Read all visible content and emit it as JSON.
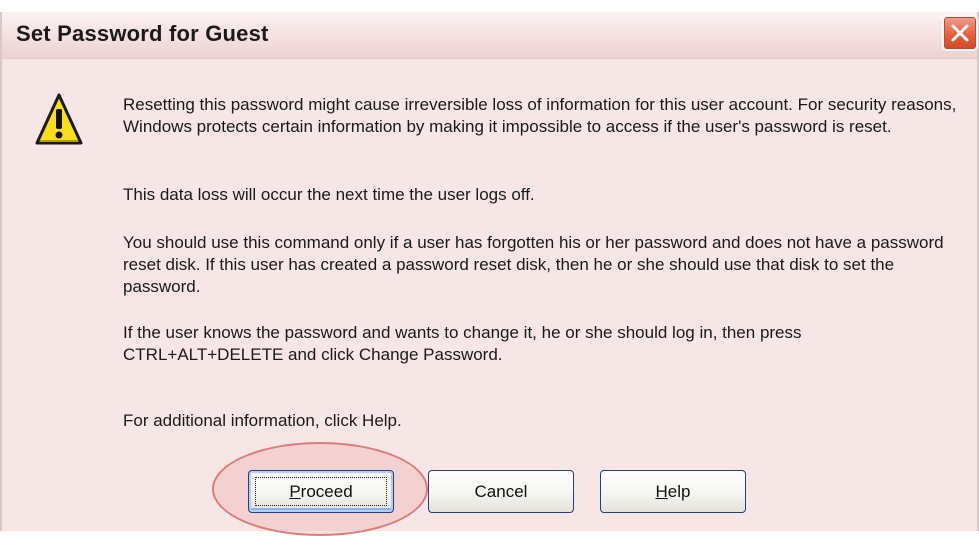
{
  "window": {
    "title": "Set Password for Guest"
  },
  "icons": {
    "close": "close-icon",
    "warning": "warning-icon"
  },
  "message": {
    "paragraphs": [
      "Resetting this password might cause irreversible loss of information for this user account. For security reasons, Windows protects certain information by making it impossible to access if the user's password is reset.",
      "This data loss will occur the next time the user logs off.",
      "You should use this command only if a user has forgotten his or her password and does not have a password reset disk. If this user has created a password reset disk, then he or she should use that disk to set the password.",
      "If the user knows the password and wants to change it, he or she should log in, then press CTRL+ALT+DELETE and click Change Password.",
      "For additional information, click Help."
    ]
  },
  "buttons": {
    "proceed": {
      "accel": "P",
      "rest": "roceed"
    },
    "cancel": {
      "label": "Cancel"
    },
    "help": {
      "accel": "H",
      "rest": "elp"
    }
  },
  "colors": {
    "dialog_background": "#f6e6e6",
    "close_button": "#e2613f",
    "button_border": "#1c3f86",
    "highlight": "#e07a7a"
  }
}
